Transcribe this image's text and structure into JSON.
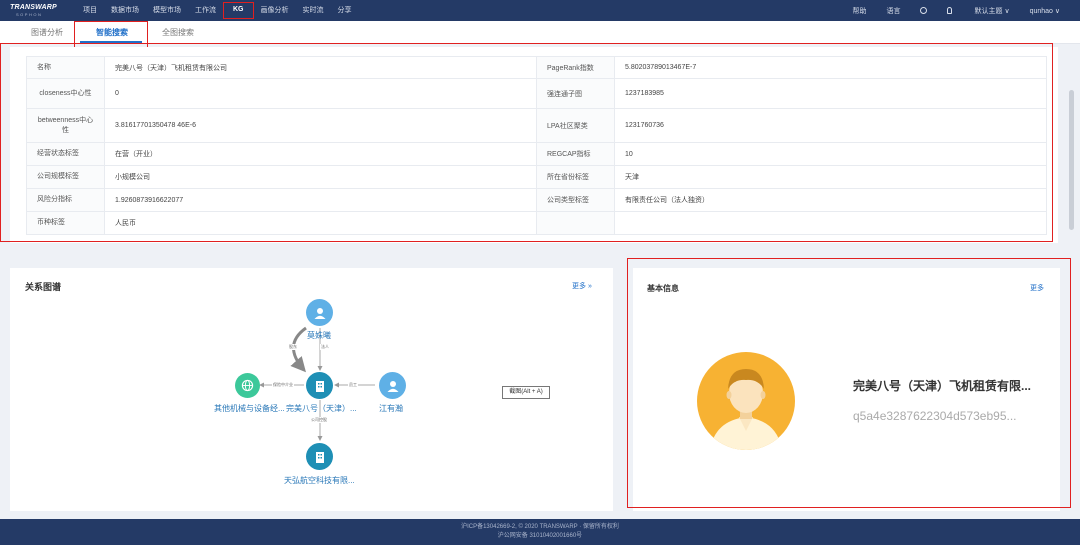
{
  "header": {
    "logo_main": "TRANSWARP",
    "logo_sub": "SOPHON",
    "nav": [
      "项目",
      "数据市场",
      "模型市场",
      "工作流",
      "KG",
      "画像分析",
      "实时流",
      "分享"
    ],
    "active_nav": "KG",
    "right": {
      "help": "帮助",
      "language": "语言",
      "theme": "默认主题",
      "user": "qunhao"
    }
  },
  "tabs": [
    "图谱分析",
    "智能搜索",
    "全图搜索"
  ],
  "active_tab": "智能搜索",
  "info_rows": [
    {
      "k1": "名称",
      "v1": "完美八号（天津）飞机租赁有限公司",
      "k2": "PageRank指数",
      "v2": "5.80203789013467E-7"
    },
    {
      "k1": "closeness中心性",
      "v1": "0",
      "k2": "强连通子图",
      "v2": "1237183985"
    },
    {
      "k1": "betweenness中心性",
      "v1": "3.81617701350478 46E-6",
      "k2": "LPA社区聚类",
      "v2": "1231760736"
    },
    {
      "k1": "经营状态标签",
      "v1": "在营（开业）",
      "k2": "REGCAP指标",
      "v2": "10"
    },
    {
      "k1": "公司规模标签",
      "v1": "小规模公司",
      "k2": "所在省份标签",
      "v2": "天津"
    },
    {
      "k1": "风险分指标",
      "v1": "1.9260873916622077",
      "k2": "公司类型标签",
      "v2": "有限责任公司（法人独资）"
    },
    {
      "k1": "币种标签",
      "v1": "人民币",
      "k2": "",
      "v2": ""
    }
  ],
  "graph_panel": {
    "title": "关系图谱",
    "more": "更多 »",
    "nodes": {
      "top": "莫姝曦",
      "left": "其他机械与设备经...",
      "center": "完美八号（天津）...",
      "right": "江有瀚",
      "bottom": "天弘航空科技有限..."
    },
    "edges": {
      "top_left": "股东",
      "top_right": "法人",
      "left": "保险中介业",
      "right": "员工",
      "bottom": "公司控股"
    },
    "tooltip": "截图(Alt + A)"
  },
  "basic_panel": {
    "title": "基本信息",
    "more": "更多",
    "company_name": "完美八号（天津）飞机租赁有限...",
    "company_id": "q5a4e3287622304d573eb95..."
  },
  "footer": {
    "line1": "沪ICP备13042669-2, © 2020 TRANSWARP · 保留所有权利",
    "line2": "沪公网安备 31010402001660号"
  },
  "colors": {
    "nav_bg": "#243a66",
    "accent": "#1f6fc8",
    "highlight": "#e02020",
    "node_blue": "#5fb0e6",
    "node_teal": "#1e8fb5",
    "node_green": "#3cc89a"
  }
}
